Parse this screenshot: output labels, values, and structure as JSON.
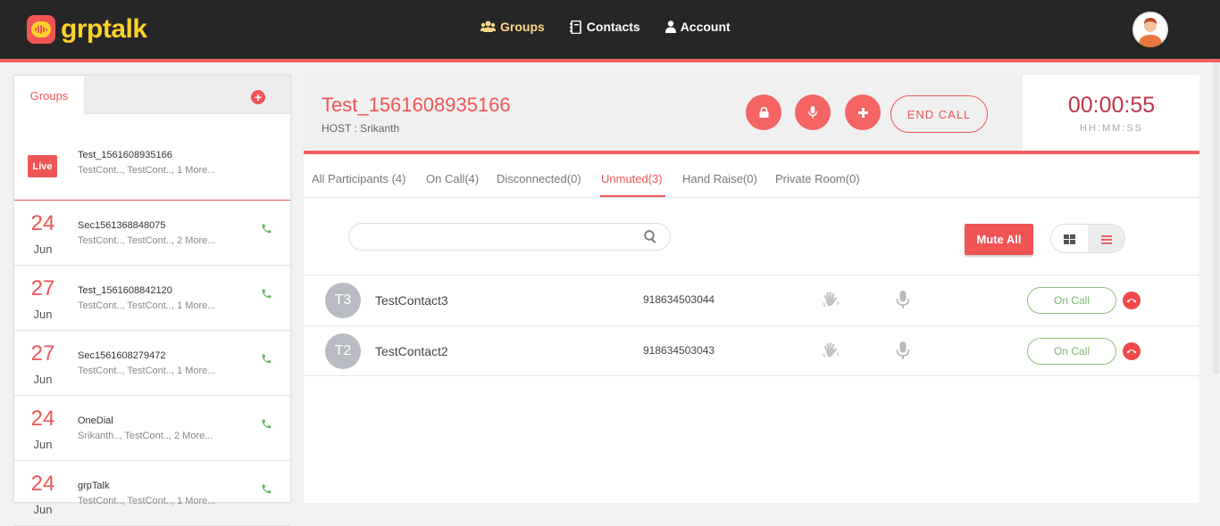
{
  "app": {
    "logo_text": "grptalk"
  },
  "nav": {
    "groups": "Groups",
    "contacts": "Contacts",
    "account": "Account"
  },
  "left": {
    "tab_label": "Groups",
    "add_symbol": "+",
    "live_label": "Live",
    "items": [
      {
        "name": "Test_1561608935166",
        "sub": "TestCont.., TestCont..,  1 More..."
      },
      {
        "day": "24",
        "month": "Jun",
        "name": "Sec1561368848075",
        "sub": "TestCont.., TestCont..,  2 More..."
      },
      {
        "day": "27",
        "month": "Jun",
        "name": "Test_1561608842120",
        "sub": "TestCont.., TestCont..,  1 More..."
      },
      {
        "day": "27",
        "month": "Jun",
        "name": "Sec1561608279472",
        "sub": "TestCont.., TestCont..,  1 More..."
      },
      {
        "day": "24",
        "month": "Jun",
        "name": "OneDial",
        "sub": "Srikanth.., TestCont..,  2 More..."
      },
      {
        "day": "24",
        "month": "Jun",
        "name": "grpTalk",
        "sub": "TestCont.., TestCont..,  1 More..."
      }
    ]
  },
  "call": {
    "title": "Test_1561608935166",
    "host": "HOST : Srikanth",
    "end_label": "END CALL",
    "timer": "00:00:55",
    "timer_format": "HH:MM:SS"
  },
  "tabs": [
    "All Participants (4)",
    "On Call(4)",
    "Disconnected(0)",
    "Unmuted(3)",
    "Hand Raise(0)",
    "Private Room(0)"
  ],
  "toolbar": {
    "mute_all": "Mute  All",
    "search_placeholder": ""
  },
  "participants": [
    {
      "initials": "T3",
      "name": "TestContact3",
      "number": "918634503044",
      "status": "On Call"
    },
    {
      "initials": "T2",
      "name": "TestContact2",
      "number": "918634503043",
      "status": "On Call"
    }
  ],
  "colors": {
    "accent": "#f05455",
    "brand_yellow": "#ffd12b",
    "header": "#262626",
    "status_green": "#7bb86a"
  }
}
